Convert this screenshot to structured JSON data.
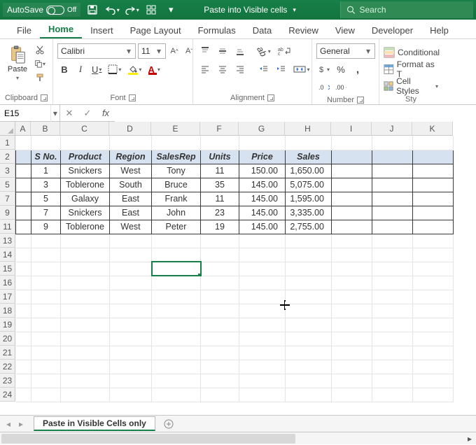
{
  "titlebar": {
    "autosave_label": "AutoSave",
    "autosave_state": "Off",
    "filename": "Paste into Visible cells",
    "search_placeholder": "Search"
  },
  "tabs": [
    "File",
    "Home",
    "Insert",
    "Page Layout",
    "Formulas",
    "Data",
    "Review",
    "View",
    "Developer",
    "Help"
  ],
  "active_tab": 1,
  "ribbon": {
    "clipboard": {
      "label": "Clipboard",
      "paste": "Paste"
    },
    "font": {
      "label": "Font",
      "name": "Calibri",
      "size": "11"
    },
    "alignment": {
      "label": "Alignment"
    },
    "number": {
      "label": "Number",
      "format": "General"
    },
    "styles": {
      "label": "Sty",
      "items": [
        "Conditional",
        "Format as T",
        "Cell Styles"
      ]
    }
  },
  "namebox": "E15",
  "formula": "",
  "columns": [
    "A",
    "B",
    "C",
    "D",
    "E",
    "F",
    "G",
    "H",
    "I",
    "J",
    "K"
  ],
  "row_numbers": [
    1,
    2,
    3,
    5,
    7,
    9,
    11,
    13,
    14,
    15,
    16,
    17,
    18,
    19,
    20,
    21,
    22,
    23,
    24
  ],
  "table": {
    "headers": [
      "S No.",
      "Product",
      "Region",
      "SalesRep",
      "Units",
      "Price",
      "Sales"
    ],
    "rows": [
      {
        "sno": "1",
        "product": "Snickers",
        "region": "West",
        "rep": "Tony",
        "units": "11",
        "price": "150.00",
        "sales": "1,650.00"
      },
      {
        "sno": "3",
        "product": "Toblerone",
        "region": "South",
        "rep": "Bruce",
        "units": "35",
        "price": "145.00",
        "sales": "5,075.00"
      },
      {
        "sno": "5",
        "product": "Galaxy",
        "region": "East",
        "rep": "Frank",
        "units": "11",
        "price": "145.00",
        "sales": "1,595.00"
      },
      {
        "sno": "7",
        "product": "Snickers",
        "region": "East",
        "rep": "John",
        "units": "23",
        "price": "145.00",
        "sales": "3,335.00"
      },
      {
        "sno": "9",
        "product": "Toblerone",
        "region": "West",
        "rep": "Peter",
        "units": "19",
        "price": "145.00",
        "sales": "2,755.00"
      }
    ]
  },
  "active_cell": "E15",
  "sheet_tab": "Paste in Visible Cells only",
  "colors": {
    "accent": "#178048"
  }
}
